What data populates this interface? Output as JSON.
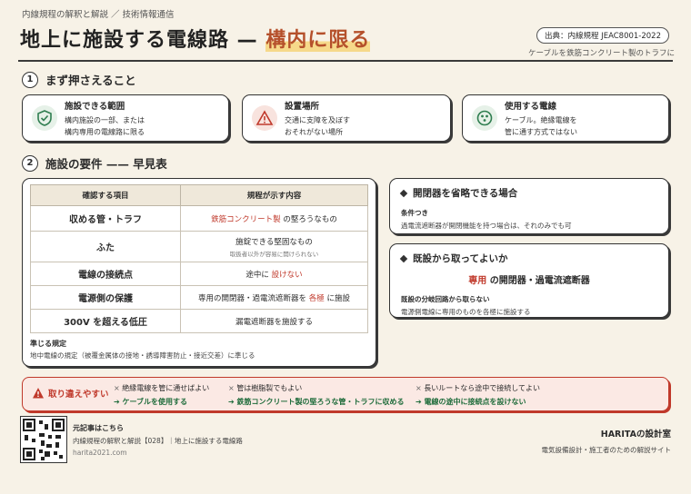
{
  "header": {
    "breadcrumb": "内線規程の解釈と解説 ／ 技術情報通信",
    "title_main": "地上に施設する電線路 — ",
    "title_highlight": "構内に限る",
    "source_badge": "出典：内線規程 JEAC8001-2022",
    "scope_note": "ケーブルを鉄筋コンクリート製のトラフに"
  },
  "section1": {
    "number": "1",
    "title": "まず押さえること",
    "cards": [
      {
        "icon": "shield-check-icon",
        "title": "施設できる範囲",
        "text": "構内施設の一部、または\n構内専用の電線路に限る"
      },
      {
        "icon": "warning-triangle-icon",
        "title": "設置場所",
        "text": "交通に支障を及ぼす\nおそれがない場所"
      },
      {
        "icon": "cable-plug-icon",
        "title": "使用する電線",
        "text": "ケーブル。絶縁電線を\n管に通す方式ではない"
      }
    ]
  },
  "section2": {
    "number": "2",
    "title": "施設の要件 —— 早見表",
    "table": {
      "headers": [
        "確認する項目",
        "規程が示す内容"
      ],
      "rows": [
        {
          "item": "収める管・トラフ",
          "desc_pre": "",
          "desc_red": "鉄筋コンクリート製",
          "desc_post": " の堅ろうなもの",
          "note": ""
        },
        {
          "item": "ふた",
          "desc_pre": "施錠できる堅固なもの",
          "desc_red": "",
          "desc_post": "",
          "note": "取扱者以外が容易に開けられない"
        },
        {
          "item": "電線の接続点",
          "desc_pre": "途中に ",
          "desc_red": "設けない",
          "desc_post": "",
          "note": ""
        },
        {
          "item": "電源側の保護",
          "desc_pre": "専用の開閉器・過電流遮断器を ",
          "desc_red": "各極",
          "desc_post": " に施設",
          "note": ""
        },
        {
          "item": "300V を超える低圧",
          "desc_pre": "漏電遮断器を施設する",
          "desc_red": "",
          "desc_post": "",
          "note": ""
        }
      ]
    },
    "related_title": "準じる規定",
    "related_text": "地中電線の規定（被覆金属体の接地・誘導障害防止・接近交差）に準じる"
  },
  "side": {
    "omit": {
      "title": "開閉器を省略できる場合",
      "cond_label": "条件つき",
      "cond_text": "過電流遮断器が開閉機能を持つ場合は、それのみでも可"
    },
    "branch": {
      "title": "既設から取ってよいか",
      "highlight": "専用",
      "rest": " の開閉器・過電流遮断器",
      "note_label": "既設の分岐回路から取らない",
      "note_text": "電源側電線に専用のものを各極に施設する"
    }
  },
  "caution": {
    "label": "取り違えやすい",
    "items": [
      {
        "wrong": "絶縁電線を管に通せばよい",
        "right": "ケーブルを使用する"
      },
      {
        "wrong": "管は樹脂製でもよい",
        "right": "鉄筋コンクリート製の堅ろうな管・トラフに収める"
      },
      {
        "wrong": "長いルートなら途中で接続してよい",
        "right": "電線の途中に接続点を設けない"
      }
    ]
  },
  "footer": {
    "orig_label": "元記事はこちら",
    "orig_title": "内線規程の解釈と解説【028】｜地上に施設する電線路",
    "url": "harita2021.com",
    "brand": "HARITAの設計室",
    "tagline": "電気設備設計・施工者のための解説サイト"
  },
  "colors": {
    "accent_red": "#c0392b",
    "accent_green": "#2e7d4f",
    "highlight": "#f6d98a"
  }
}
